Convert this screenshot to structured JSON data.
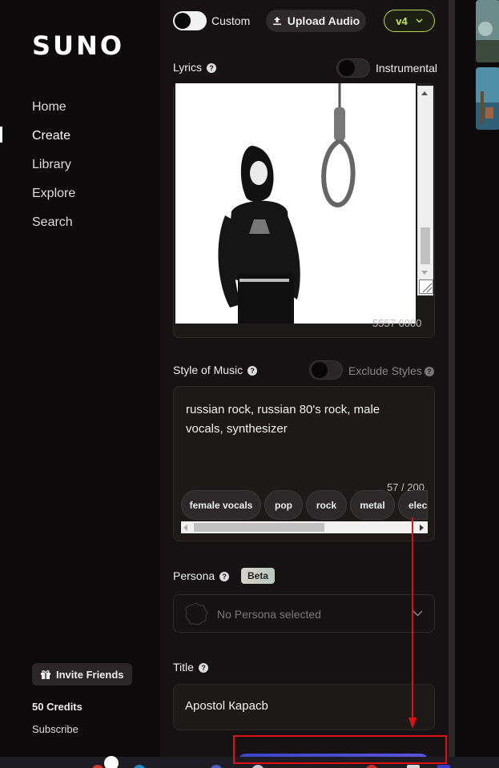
{
  "sidebar": {
    "logo": "SUNO",
    "nav": [
      {
        "label": "Home"
      },
      {
        "label": "Create",
        "active": true
      },
      {
        "label": "Library"
      },
      {
        "label": "Explore"
      },
      {
        "label": "Search"
      }
    ],
    "invite_label": "Invite Friends",
    "credits_label": "50 Credits",
    "subscribe_label": "Subscribe"
  },
  "top": {
    "custom_label": "Custom",
    "custom_on": true,
    "upload_label": "Upload Audio",
    "model_label": "v4"
  },
  "lyrics": {
    "label": "Lyrics",
    "instrumental_label": "Instrumental",
    "instrumental_on": false,
    "char_count": "5557 6000"
  },
  "style": {
    "label": "Style of Music",
    "exclude_label": "Exclude Styles",
    "exclude_on": false,
    "value": "russian rock, russian 80's rock, male vocals, synthesizer",
    "char_count": "57 / 200",
    "tags": [
      "female vocals",
      "pop",
      "rock",
      "metal",
      "elec"
    ],
    "scroll_fraction": 0.53
  },
  "persona": {
    "label": "Persona",
    "badge": "Beta",
    "placeholder": "No Persona selected"
  },
  "title": {
    "label": "Title",
    "value": "Apostol Карасb"
  },
  "colors": {
    "accent_green": "#c8e85a",
    "annotation_red": "#e01010",
    "create_button": "#4a4ed0"
  },
  "icons": [
    "help-icon",
    "upload-icon",
    "chevron-down-icon",
    "gift-icon",
    "persona-placeholder-icon"
  ]
}
